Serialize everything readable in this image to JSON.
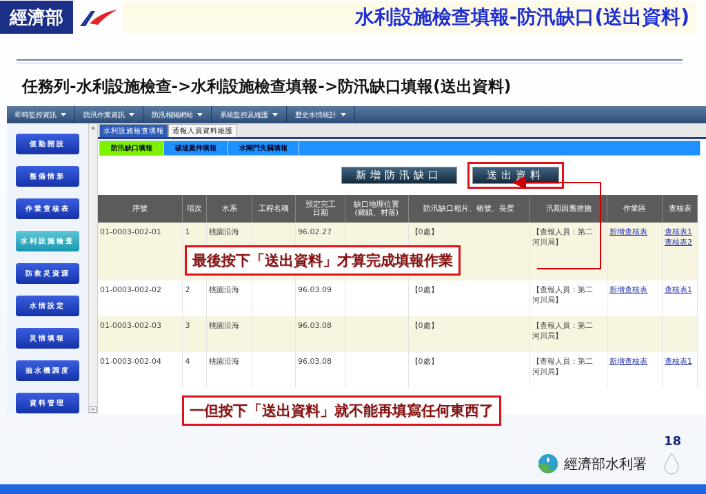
{
  "slide": {
    "logo": "經濟部",
    "title": "水利設施檢查填報-防汛缺口(送出資料)",
    "subtitle": "任務列-水利設施檢查->水利設施檢查填報->防汛缺口填報(送出資料)",
    "page_number": "18",
    "footer_org": "經濟部水利署"
  },
  "app": {
    "nav": [
      {
        "label": "即時監控資訊"
      },
      {
        "label": "防汛作業資訊"
      },
      {
        "label": "防汛相關網站"
      },
      {
        "label": "系統監控及維護"
      },
      {
        "label": "歷史水情統計"
      }
    ],
    "collapse": "«",
    "sidebar": [
      {
        "label": "值勤開設",
        "selected": false
      },
      {
        "label": "整備情形",
        "selected": false
      },
      {
        "label": "作業查核表",
        "selected": false
      },
      {
        "label": "水利設施檢查",
        "selected": true
      },
      {
        "label": "防救災資源",
        "selected": false
      },
      {
        "label": "水情設定",
        "selected": false
      },
      {
        "label": "災情填報",
        "selected": false
      },
      {
        "label": "抽水機調度",
        "selected": false
      },
      {
        "label": "資料管理",
        "selected": false
      }
    ],
    "tabs": [
      {
        "label": "水利設施檢查填報",
        "selected": true
      },
      {
        "label": "通報人員資料維護",
        "selected": false
      }
    ],
    "subtabs": [
      {
        "label": "防汛缺口填報",
        "selected": true
      },
      {
        "label": "破堤案件填報",
        "selected": false
      },
      {
        "label": "水閘門失竊填報",
        "selected": false
      }
    ],
    "buttons": [
      {
        "label": "新增防汛缺口",
        "highlighted": false
      },
      {
        "label": "送出資料",
        "highlighted": true
      }
    ],
    "table": {
      "columns": [
        {
          "lines": [
            "序號"
          ]
        },
        {
          "lines": [
            "項次"
          ]
        },
        {
          "lines": [
            "水系"
          ]
        },
        {
          "lines": [
            "工程名稱"
          ]
        },
        {
          "lines": [
            "預定完工",
            "日期"
          ]
        },
        {
          "lines": [
            "缺口地理位置",
            "(鄉鎮、村落)"
          ]
        },
        {
          "lines": [
            "防汛缺口相片、樁號、長度"
          ]
        },
        {
          "lines": [
            "汛期因應措施"
          ]
        },
        {
          "lines": [
            "作業區"
          ]
        },
        {
          "lines": [
            "查核表"
          ]
        }
      ],
      "rows": [
        {
          "id": "01-0003-002-01",
          "item": "1",
          "river": "桃園沿海",
          "date": "96.02.27",
          "photos": "【0處】",
          "measures": "【查報人員：第二河川局】",
          "action": "新增查核表",
          "checklists": [
            "查核表1",
            "查核表2"
          ]
        },
        {
          "id": "01-0003-002-02",
          "item": "2",
          "river": "桃園沿海",
          "date": "96.03.09",
          "photos": "【0處】",
          "measures": "【查報人員：第二河川局】",
          "action": "新增查核表",
          "checklists": [
            "查核表1"
          ]
        },
        {
          "id": "01-0003-002-03",
          "item": "3",
          "river": "桃園沿海",
          "date": "96.03.08",
          "photos": "【0處】",
          "measures": "【查報人員：第二河川局】"
        },
        {
          "id": "01-0003-002-04",
          "item": "4",
          "river": "桃園沿海",
          "date": "96.03.08",
          "photos": "【0處】",
          "measures": "【查報人員：第二河川局】",
          "action": "新增查核表",
          "checklists": [
            "查核表1"
          ]
        }
      ]
    }
  },
  "callouts": [
    {
      "text": "最後按下「送出資料」才算完成填報作業"
    },
    {
      "text": "一但按下「送出資料」就不能再填寫任何東西了"
    }
  ]
}
